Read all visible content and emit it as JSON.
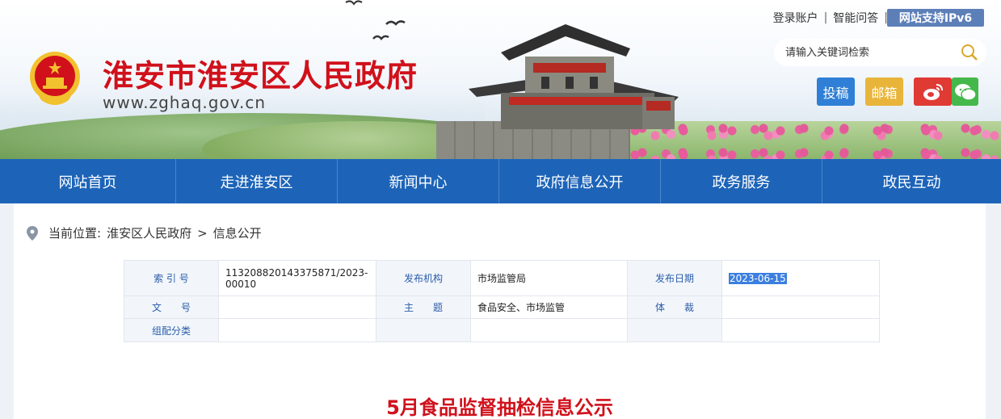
{
  "header": {
    "site_title": "淮安市淮安区人民政府",
    "site_url": "www.zghaq.gov.cn",
    "top_links": [
      "登录账户",
      "智能问答"
    ],
    "ipv6_badge": "网站支持IPv6",
    "search": {
      "placeholder": "请输入关键词检索"
    },
    "quick_buttons": {
      "submit": "投稿",
      "mail": "邮箱",
      "weibo_icon": "weibo-icon",
      "wechat_icon": "wechat-icon"
    }
  },
  "nav": {
    "items": [
      "网站首页",
      "走进淮安区",
      "新闻中心",
      "政府信息公开",
      "政务服务",
      "政民互动"
    ]
  },
  "breadcrumb": {
    "prefix": "当前位置:",
    "items": [
      "淮安区人民政府",
      "信息公开"
    ],
    "separator": ">"
  },
  "meta": {
    "labels": {
      "index_no": "索 引 号",
      "publisher": "发布机构",
      "publish_date": "发布日期",
      "doc_no": "文　　号",
      "subject": "主　　题",
      "genre": "体　　裁",
      "category": "组配分类"
    },
    "values": {
      "index_no": "113208820143375871/2023-00010",
      "publisher": "市场监管局",
      "publish_date": "2023-06-15",
      "doc_no": "",
      "subject": "食品安全、市场监管",
      "genre": "",
      "category": ""
    }
  },
  "article": {
    "title": "5月食品监督抽检信息公示"
  },
  "colors": {
    "brand_red": "#d0111b",
    "nav_blue": "#1d64b8",
    "ipv6_blue": "#5d7fb8"
  }
}
